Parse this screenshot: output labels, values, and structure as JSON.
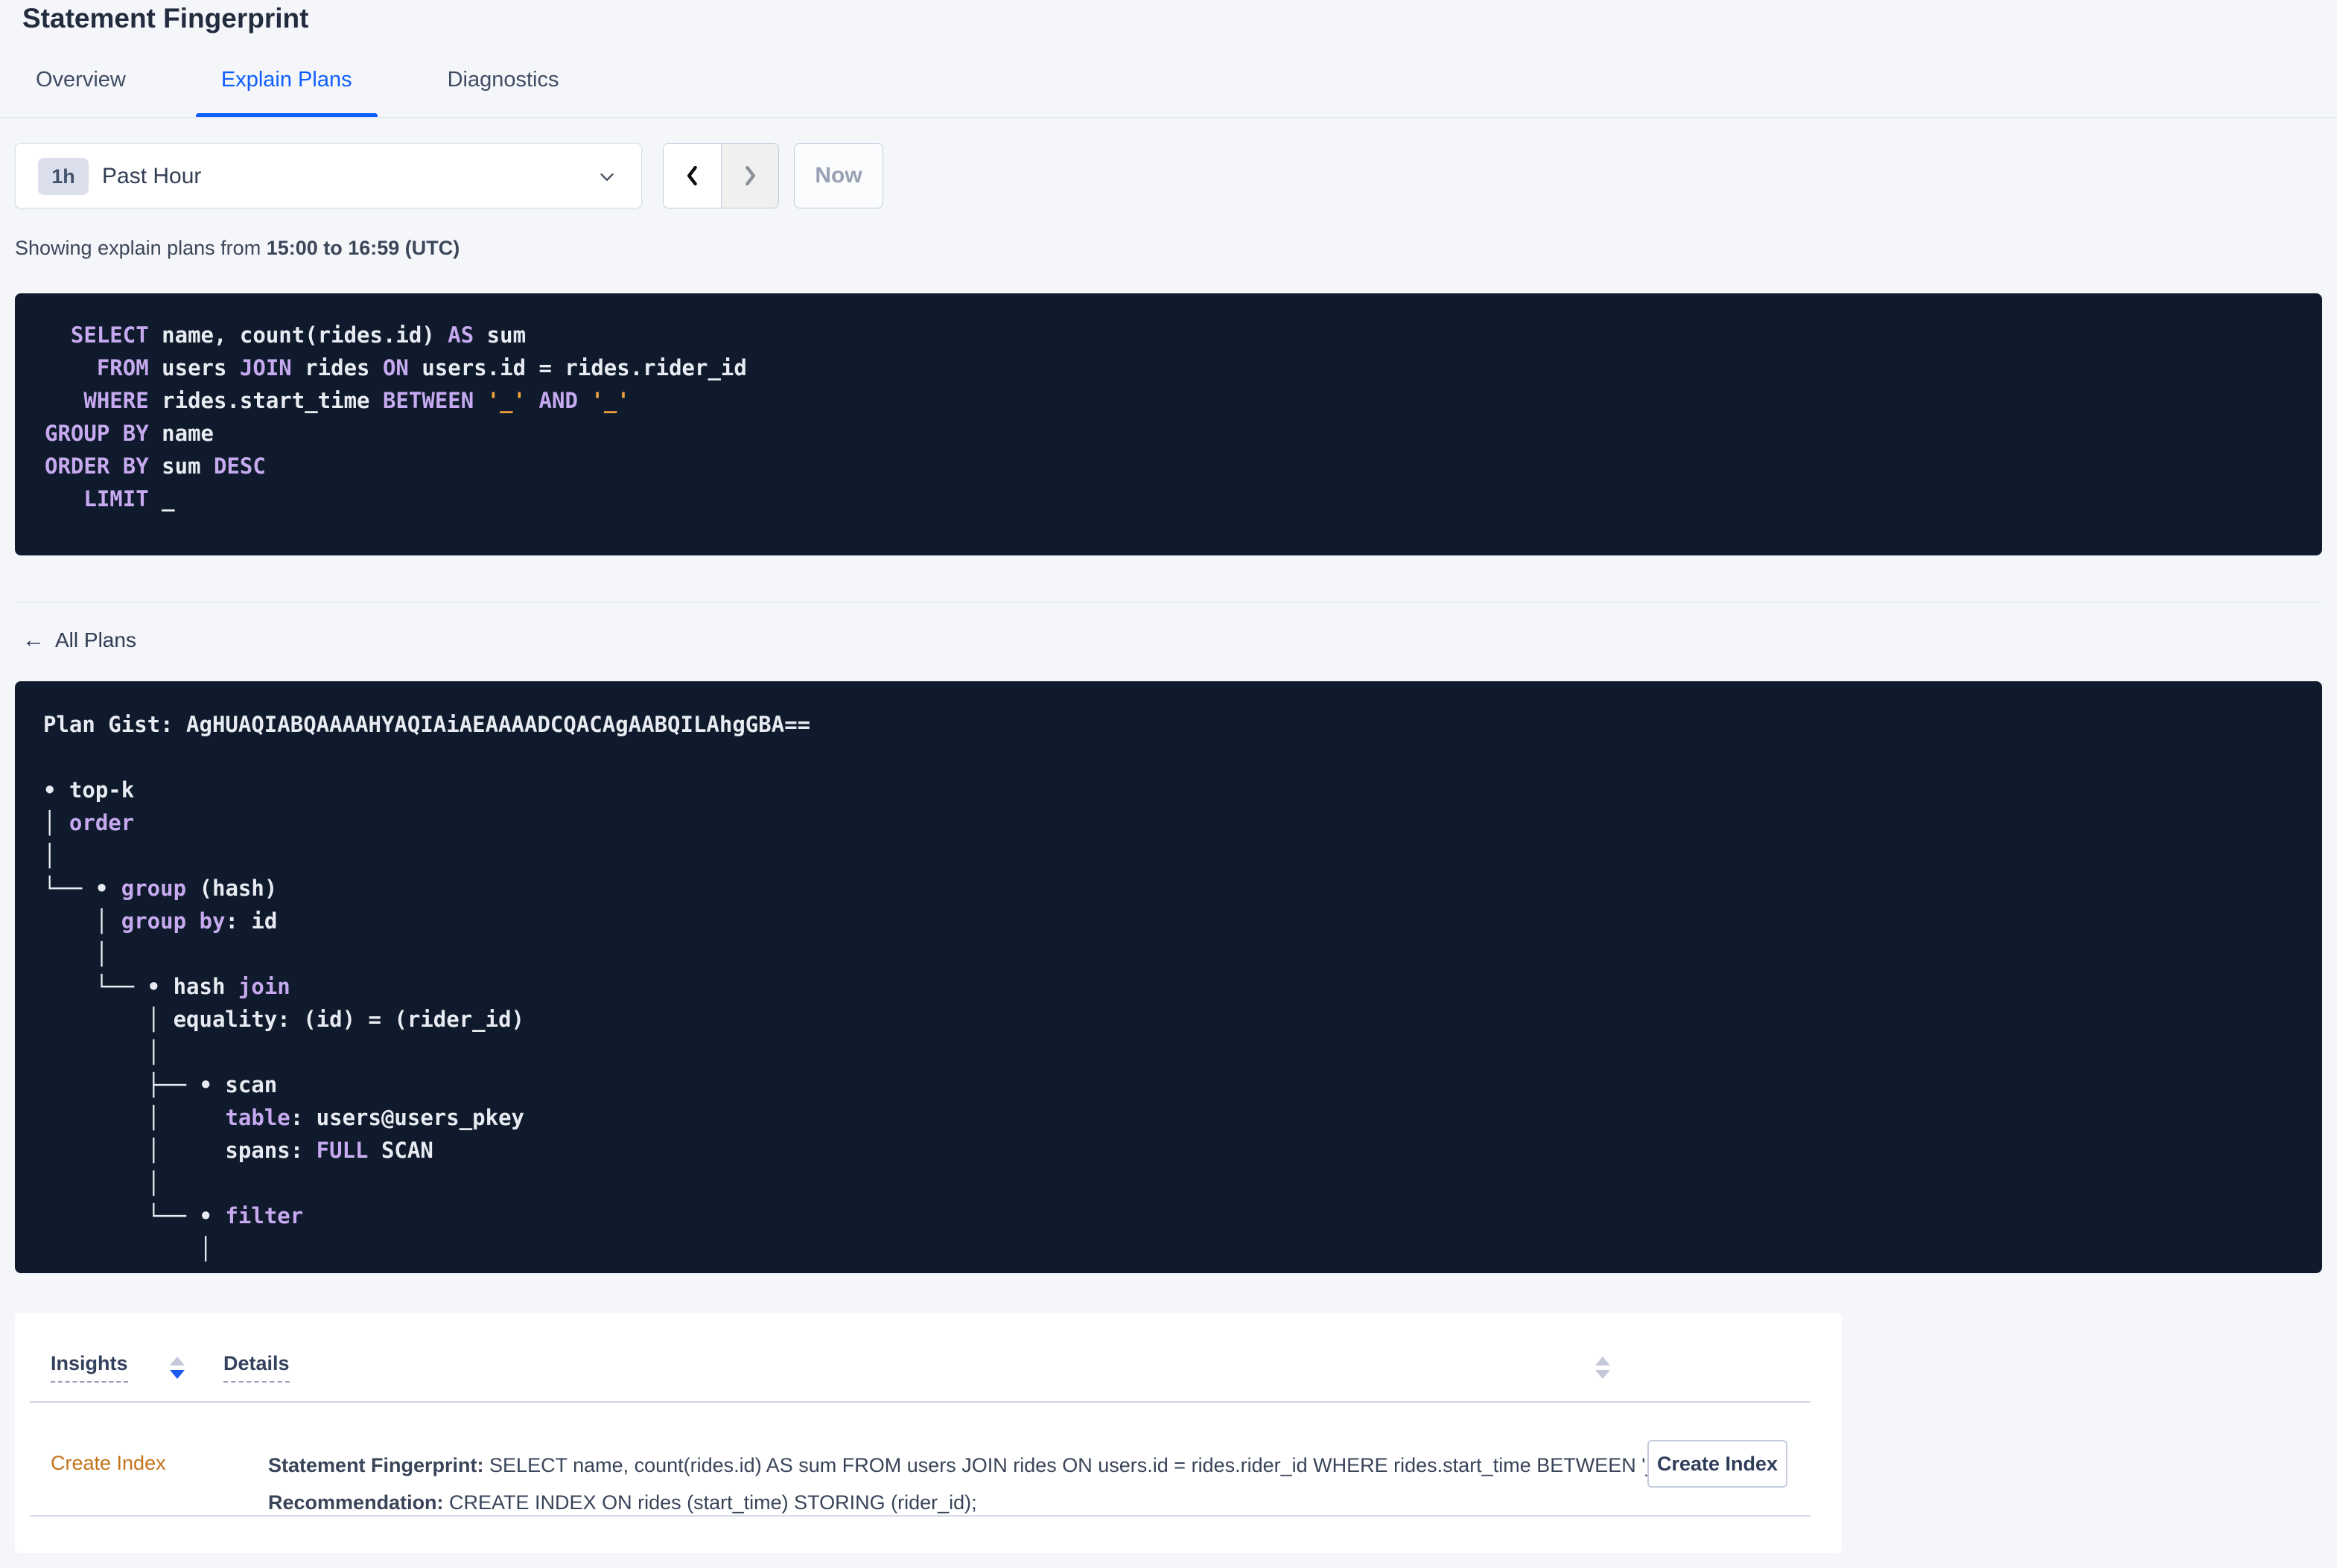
{
  "page": {
    "title": "Statement Fingerprint"
  },
  "colors": {
    "page_bg": "#f4f6fa",
    "accent_blue": "#0f5fff",
    "code_bg": "#0f1a2c",
    "code_fg": "#e8ecf2",
    "kw": "#c6a9ef",
    "lit": "#f1a13c",
    "insight_orange": "#c4731a"
  },
  "tabs": [
    {
      "label": "Overview",
      "active": false
    },
    {
      "label": "Explain Plans",
      "active": true
    },
    {
      "label": "Diagnostics",
      "active": false
    }
  ],
  "time_picker": {
    "badge": "1h",
    "label": "Past Hour",
    "now_label": "Now",
    "prev_icon": "chevron-left",
    "next_icon": "chevron-right",
    "next_disabled": true
  },
  "showing_text": {
    "prefix": "Showing explain plans from ",
    "range": "15:00 to 16:59 (UTC)"
  },
  "sql_statement": {
    "lines": [
      [
        [
          "",
          "  "
        ],
        [
          "kw",
          "SELECT"
        ],
        [
          "",
          " name, count(rides.id) "
        ],
        [
          "kw",
          "AS"
        ],
        [
          "",
          " sum"
        ]
      ],
      [
        [
          "",
          "    "
        ],
        [
          "kw",
          "FROM"
        ],
        [
          "",
          " users "
        ],
        [
          "kw",
          "JOIN"
        ],
        [
          "",
          " rides "
        ],
        [
          "kw",
          "ON"
        ],
        [
          "",
          " users.id = rides.rider_id"
        ]
      ],
      [
        [
          "",
          "   "
        ],
        [
          "kw",
          "WHERE"
        ],
        [
          "",
          " rides.start_time "
        ],
        [
          "kw",
          "BETWEEN"
        ],
        [
          "",
          " "
        ],
        [
          "lit",
          "'_'"
        ],
        [
          "",
          " "
        ],
        [
          "kw",
          "AND"
        ],
        [
          "",
          " "
        ],
        [
          "lit",
          "'_'"
        ]
      ],
      [
        [
          "kw",
          "GROUP BY"
        ],
        [
          "",
          " name"
        ]
      ],
      [
        [
          "kw",
          "ORDER BY"
        ],
        [
          "",
          " sum "
        ],
        [
          "kw",
          "DESC"
        ]
      ],
      [
        [
          "",
          "   "
        ],
        [
          "kw",
          "LIMIT"
        ],
        [
          "",
          " _"
        ]
      ]
    ]
  },
  "back_link": {
    "arrow": "←",
    "label": "All Plans"
  },
  "plan": {
    "gist": "AgHUAQIABQAAAAHYAQIAiAEAAAADCQACAgAABQILAhgGBA==",
    "lines": [
      [
        [
          "b",
          "Plan Gist: AgHUAQIABQAAAAHYAQIAiAEAAAADCQACAgAABQILAhgGBA=="
        ]
      ],
      [],
      [
        [
          "",
          "• top-k"
        ]
      ],
      [
        [
          "",
          "│ "
        ],
        [
          "kw",
          "order"
        ]
      ],
      [
        [
          "",
          "│"
        ]
      ],
      [
        [
          "",
          "└── • "
        ],
        [
          "kw",
          "group"
        ],
        [
          "",
          " (hash)"
        ]
      ],
      [
        [
          "",
          "    │ "
        ],
        [
          "kw",
          "group by"
        ],
        [
          "",
          ": id"
        ]
      ],
      [
        [
          "",
          "    │"
        ]
      ],
      [
        [
          "",
          "    └── • hash "
        ],
        [
          "kw",
          "join"
        ]
      ],
      [
        [
          "",
          "        │ equality: (id) = (rider_id)"
        ]
      ],
      [
        [
          "",
          "        │"
        ]
      ],
      [
        [
          "",
          "        ├── • scan"
        ]
      ],
      [
        [
          "",
          "        │     "
        ],
        [
          "kw",
          "table"
        ],
        [
          "",
          ": users@users_pkey"
        ]
      ],
      [
        [
          "",
          "        │     spans: "
        ],
        [
          "kw",
          "FULL"
        ],
        [
          "",
          " SCAN"
        ]
      ],
      [
        [
          "",
          "        │"
        ]
      ],
      [
        [
          "",
          "        └── • "
        ],
        [
          "kw",
          "filter"
        ]
      ],
      [
        [
          "",
          "            │"
        ]
      ]
    ]
  },
  "insights_table": {
    "columns": [
      "Insights",
      "Details"
    ],
    "sort": {
      "insights": "desc",
      "details": "none"
    },
    "rows": [
      {
        "insight": "Create Index",
        "fingerprint_label": "Statement Fingerprint:",
        "fingerprint_value": " SELECT name, count(rides.id) AS sum FROM users JOIN rides ON users.id = rides.rider_id WHERE rides.start_time BETWEEN '_…",
        "recommendation_label": "Recommendation:",
        "recommendation_value": " CREATE INDEX ON rides (start_time) STORING (rider_id);",
        "action_label": "Create Index"
      }
    ]
  }
}
